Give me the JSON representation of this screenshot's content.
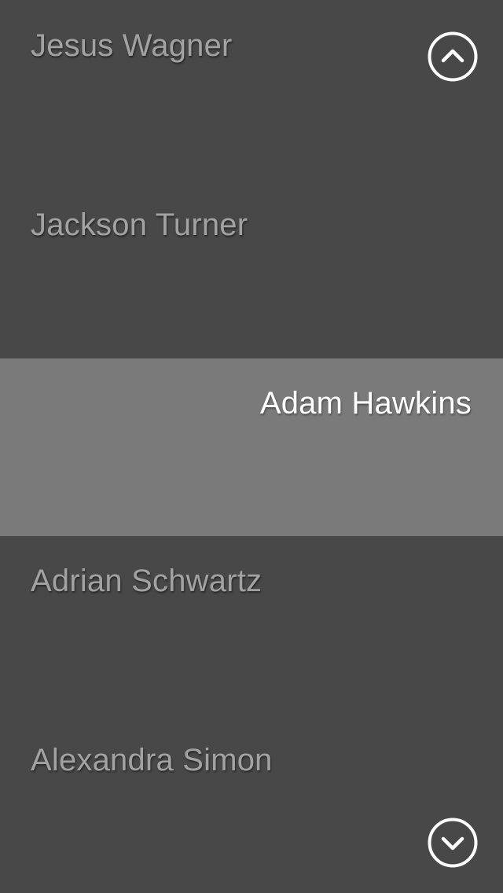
{
  "contacts": [
    {
      "name": "Jesus Wagner",
      "selected": false
    },
    {
      "name": "Jackson Turner",
      "selected": false
    },
    {
      "name": "Adam Hawkins",
      "selected": true
    },
    {
      "name": "Adrian Schwartz",
      "selected": false
    },
    {
      "name": "Alexandra Simon",
      "selected": false
    }
  ],
  "controls": {
    "up_icon": "chevron-up-circle-icon",
    "down_icon": "chevron-down-circle-icon"
  },
  "colors": {
    "background": "#484848",
    "selected_background": "#7a7a7a",
    "text": "#a2a2a2",
    "selected_text": "#ffffff",
    "icon": "#ffffff"
  }
}
